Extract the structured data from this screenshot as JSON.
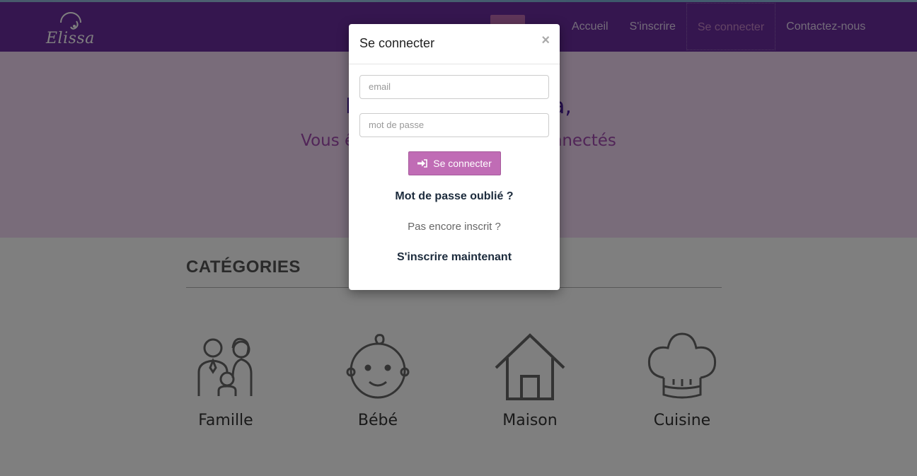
{
  "brand": {
    "name": "Elissa"
  },
  "nav": {
    "links": [
      {
        "label": "Accueil"
      },
      {
        "label": "S'inscrire"
      },
      {
        "label": "Se connecter"
      },
      {
        "label": "Contactez-nous"
      }
    ]
  },
  "hero": {
    "title": "Bienvenue sur Elissa,",
    "subtitle": "Vous êtes actuellement non connectés"
  },
  "categories": {
    "title": "CATÉGORIES",
    "items": [
      {
        "label": "Famille",
        "icon": "family-icon"
      },
      {
        "label": "Bébé",
        "icon": "baby-icon"
      },
      {
        "label": "Maison",
        "icon": "house-icon"
      },
      {
        "label": "Cuisine",
        "icon": "chef-hat-icon"
      }
    ]
  },
  "modal": {
    "title": "Se connecter",
    "close": "×",
    "email_placeholder": "email",
    "password_placeholder": "mot de passe",
    "login_button": "Se connecter",
    "forgot_link": "Mot de passe oublié ?",
    "not_registered": "Pas encore inscrit ?",
    "register_link": "S'inscrire maintenant"
  },
  "colors": {
    "navbar": "#6b2c9e",
    "accent": "#c06cb5",
    "hero_bg": "#f3d8f4"
  }
}
